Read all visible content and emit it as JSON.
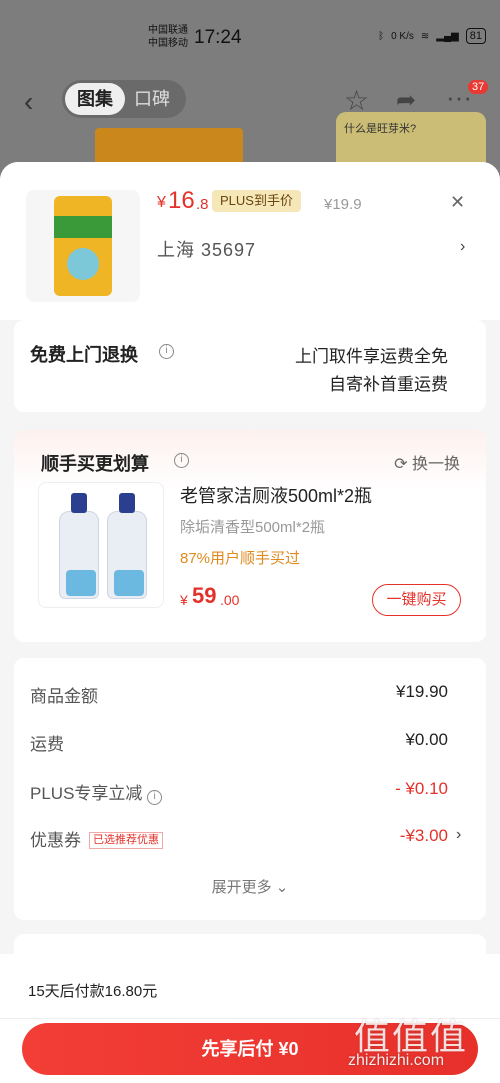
{
  "status_bar": {
    "carrier1": "中国联通",
    "carrier2": "中国移动",
    "time": "17:24",
    "net_speed": "0 K/s",
    "battery": "81"
  },
  "top_nav": {
    "tab_active": "图集",
    "tab_inactive": "口碑",
    "badge_count": "37"
  },
  "background_card": {
    "title": "什么是旺芽米?"
  },
  "product": {
    "price_symbol": "¥",
    "price_int": "16",
    "price_dec": ".8",
    "plus_tag": "PLUS到手价",
    "original_price": "¥19.9",
    "address": "上海  35697"
  },
  "return_service": {
    "title": "免费上门退换",
    "line1": "上门取件享运费全免",
    "line2": "自寄补首重运费"
  },
  "upsell": {
    "title": "顺手买更划算",
    "refresh": "换一换",
    "name": "老管家洁厕液500ml*2瓶",
    "spec": "除垢清香型500ml*2瓶",
    "buyers": "87%用户顺手买过",
    "price_symbol": "¥",
    "price_int": "59",
    "price_dec": ".00",
    "buy_button": "一键购买"
  },
  "summary": {
    "rows": [
      {
        "label": "商品金额",
        "value": "¥19.90"
      },
      {
        "label": "运费",
        "value": "¥0.00"
      },
      {
        "label": "PLUS专享立减",
        "value": "- ¥0.10"
      },
      {
        "label": "优惠券",
        "tag": "已选推荐优惠",
        "value": "-¥3.00"
      }
    ],
    "expand": "展开更多"
  },
  "footer": {
    "pay_later_text": "15天后付款16.80元",
    "pay_button": "先享后付 ¥0"
  },
  "watermark": {
    "logo": "值值值",
    "site": "zhizhizhi.com"
  },
  "colors": {
    "accent_red": "#e4322a",
    "plus_gold": "#f6e7b8",
    "orange": "#e08a1e"
  }
}
